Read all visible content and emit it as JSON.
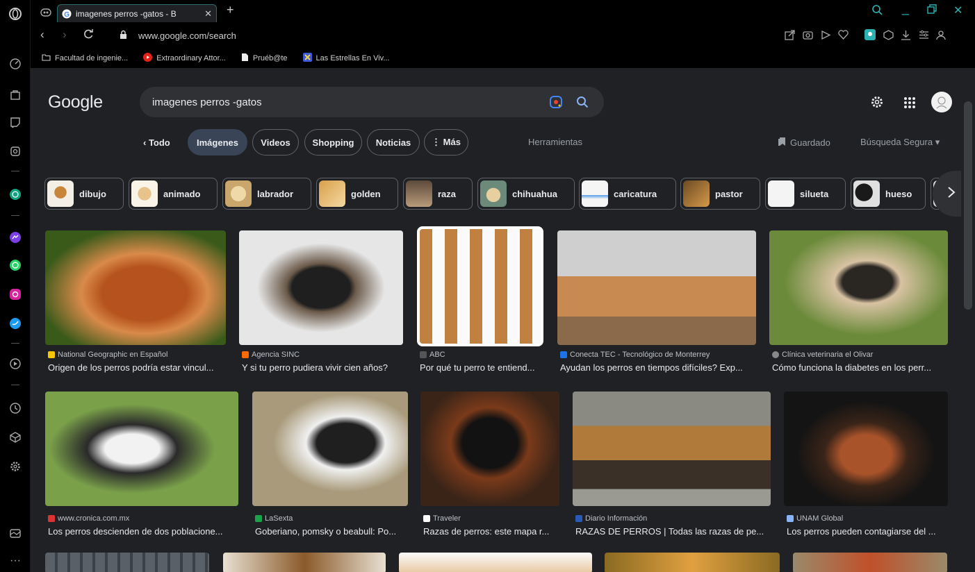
{
  "tab": {
    "title": "imagenes perros -gatos - B"
  },
  "address": {
    "url": "www.google.com/search"
  },
  "bookmarks": [
    "Facultad de ingenie...",
    "Extraordinary Attor...",
    "Pruéb@te",
    "Las Estrellas En Viv..."
  ],
  "google": {
    "logo": "Google",
    "query": "imagenes perros -gatos",
    "back_label": "‹ Todo",
    "tabs": [
      "Imágenes",
      "Videos",
      "Shopping",
      "Noticias",
      "⋮ Más"
    ],
    "tools": "Herramientas",
    "saved": "Guardado",
    "safe_search": "Búsqueda Segura ▾"
  },
  "chips": [
    "dibujo",
    "animado",
    "labrador",
    "golden",
    "raza",
    "chihuahua",
    "caricatura",
    "pastor",
    "silueta",
    "hueso"
  ],
  "results_row1": [
    {
      "source": "National Geographic en Español",
      "title": "Origen de los perros podría estar vincul..."
    },
    {
      "source": "Agencia SINC",
      "title": "Y si tu perro pudiera vivir cien años?"
    },
    {
      "source": "ABC",
      "title": "Por qué tu perro te entiend..."
    },
    {
      "source": "Conecta TEC - Tecnológico de Monterrey",
      "title": "Ayudan los perros en tiempos difíciles? Exp..."
    },
    {
      "source": "Clínica veterinaria el Olivar",
      "title": "Cómo funciona la diabetes en los perr..."
    }
  ],
  "results_row2": [
    {
      "source": "www.cronica.com.mx",
      "title": "Los perros descienden de dos poblacione..."
    },
    {
      "source": "LaSexta",
      "title": "Goberiano, pomsky o beabull: Po..."
    },
    {
      "source": "Traveler",
      "title": "Razas de perros: este mapa r..."
    },
    {
      "source": "Diario Información",
      "title": "RAZAS DE PERROS | Todas las razas de pe..."
    },
    {
      "source": "UNAM Global",
      "title": "Los perros pueden contagiarse del ..."
    }
  ],
  "colors": {
    "page_bg": "#202124",
    "search_bg": "#303134",
    "active_tab": "#394457",
    "accent_teal": "#2d6a6a"
  }
}
